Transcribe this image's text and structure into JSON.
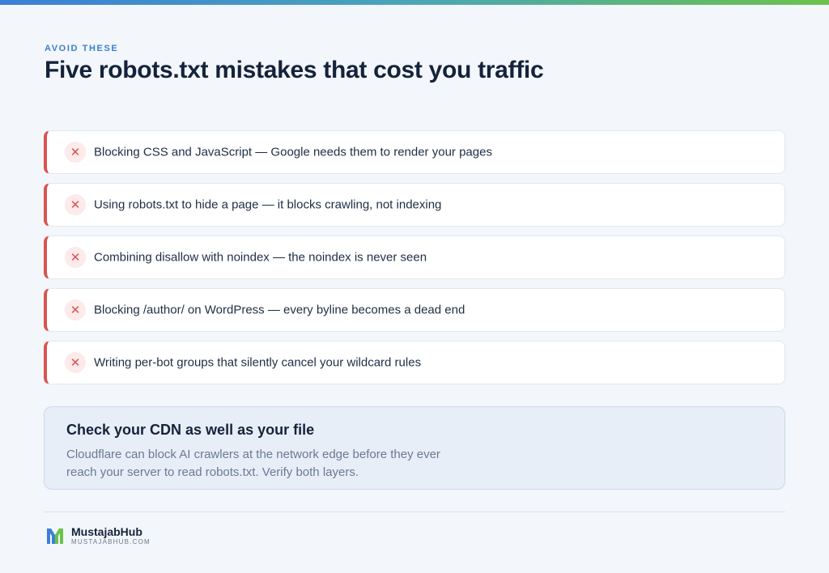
{
  "colors": {
    "accent": "#3b7fd6",
    "error": "#d9534f",
    "error_bg": "#fdeaea",
    "heading": "#14233b",
    "callout_bg": "#e8eef8"
  },
  "header": {
    "eyebrow": "AVOID THESE",
    "title": "Five robots.txt mistakes that cost you traffic"
  },
  "mistakes": [
    {
      "icon": "x-icon",
      "text": "Blocking CSS and JavaScript — Google needs them to render your pages"
    },
    {
      "icon": "x-icon",
      "text": "Using robots.txt to hide a page — it blocks crawling, not indexing"
    },
    {
      "icon": "x-icon",
      "text": "Combining disallow with noindex — the noindex is never seen"
    },
    {
      "icon": "x-icon",
      "text": "Blocking /author/ on WordPress — every byline becomes a dead end"
    },
    {
      "icon": "x-icon",
      "text": "Writing per-bot groups that silently cancel your wildcard rules"
    }
  ],
  "callout": {
    "title": "Check your CDN as well as your file",
    "body_line1": "Cloudflare can block AI crawlers at the network edge before they ever",
    "body_line2": "reach your server to read robots.txt. Verify both layers."
  },
  "footer": {
    "brand": "MustajabHub",
    "url": "MUSTAJABHUB.COM",
    "logo_icon": "brand-logo-icon"
  }
}
